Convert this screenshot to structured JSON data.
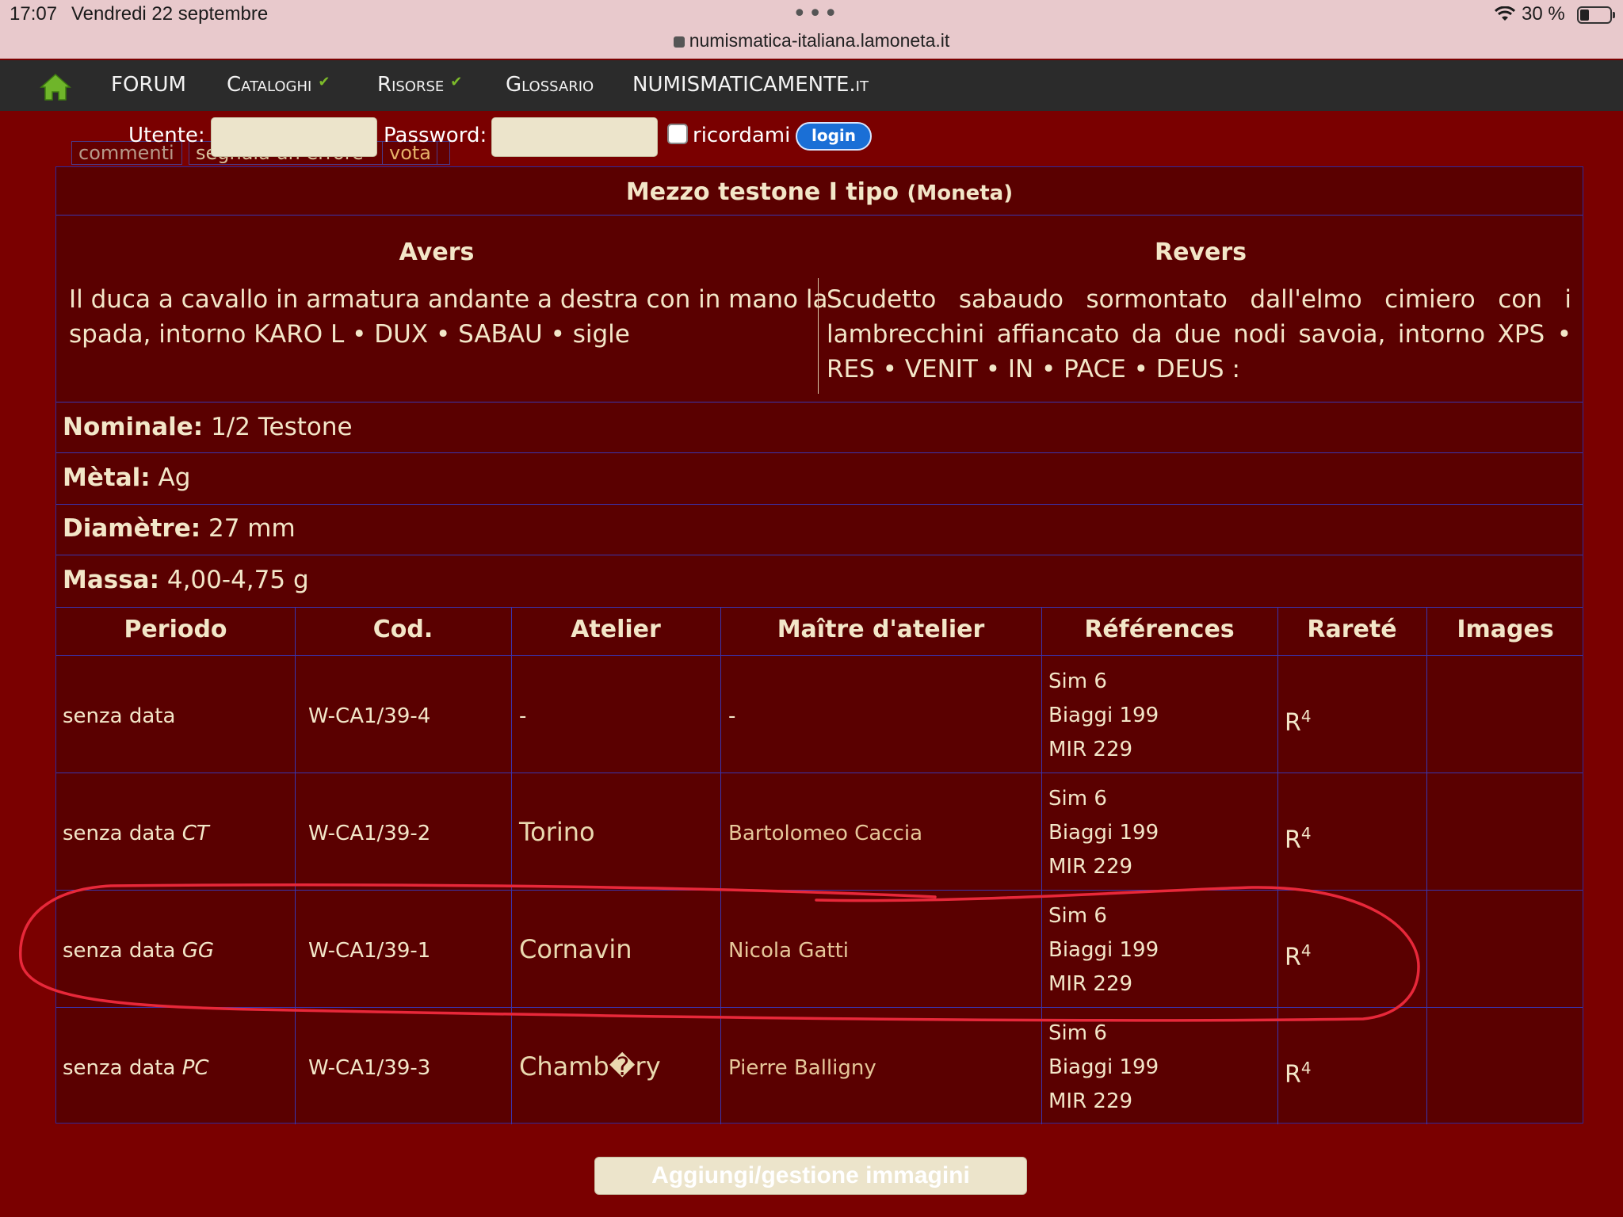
{
  "status": {
    "time": "17:07",
    "date": "Vendredi 22 septembre",
    "url": "numismatica-italiana.lamoneta.it",
    "battery": "30 %",
    "battery_level": 0.3
  },
  "nav": {
    "forum": "FORUM",
    "cataloghi": "Cataloghi",
    "risorse": "Risorse",
    "glossario": "Glossario",
    "numismaticamente": "NUMISMATICAMENTE.it"
  },
  "login": {
    "utente_label": "Utente:",
    "password_label": "Password:",
    "remember_label": "ricordami",
    "login_button": "login"
  },
  "tabs": [
    "commenti",
    "segnala un errore",
    "vota"
  ],
  "coin": {
    "title": "Mezzo testone I tipo",
    "kind": "(Moneta)",
    "avers_head": "Avers",
    "revers_head": "Revers",
    "avers_text": "Il duca a cavallo in armatura andante a destra con in mano la spada, intorno KARO L • DUX • SABAU • sigle",
    "revers_text": "Scudetto sabaudo sormontato dall'elmo cimiero con i lambrecchini affiancato da due nodi savoia, intorno XPS • RES • VENIT • IN • PACE • DEUS :",
    "nominale_label": "Nominale:",
    "nominale": "1/2 Testone",
    "metal_label": "Mètal:",
    "metal": "Ag",
    "diametre_label": "Diamètre:",
    "diametre": "27 mm",
    "massa_label": "Massa:",
    "massa": "4,00-4,75 g"
  },
  "table": {
    "headers": [
      "Periodo",
      "Cod.",
      "Atelier",
      "Maître d'atelier",
      "Références",
      "Rareté",
      "Images"
    ],
    "rows": [
      {
        "periodo": "senza data",
        "sigla": "",
        "cod": "W-CA1/39-4",
        "atelier": "-",
        "maitre": "-",
        "ref1": "Sim 6",
        "ref2": "Biaggi 199",
        "ref3": "MIR 229",
        "rarete": "R",
        "rarete_exp": "4"
      },
      {
        "periodo": "senza data",
        "sigla": "CT",
        "cod": "W-CA1/39-2",
        "atelier": "Torino",
        "maitre": "Bartolomeo Caccia",
        "ref1": "Sim 6",
        "ref2": "Biaggi 199",
        "ref3": "MIR 229",
        "rarete": "R",
        "rarete_exp": "4"
      },
      {
        "periodo": "senza data",
        "sigla": "GG",
        "cod": "W-CA1/39-1",
        "atelier": "Cornavin",
        "maitre": "Nicola Gatti",
        "ref1": "Sim 6",
        "ref2": "Biaggi 199",
        "ref3": "MIR 229",
        "rarete": "R",
        "rarete_exp": "4"
      },
      {
        "periodo": "senza data",
        "sigla": "PC",
        "cod": "W-CA1/39-3",
        "atelier": "Chamb�ry",
        "maitre": "Pierre Balligny",
        "ref1": "Sim 6",
        "ref2": "Biaggi 199",
        "ref3": "MIR 229",
        "rarete": "R",
        "rarete_exp": "4"
      }
    ]
  },
  "images_button": "Aggiungi/gestione immagini",
  "colors": {
    "page_bg": "#7a0000",
    "panel_bg": "#5a0000",
    "grid": "#3a35b0",
    "nav_bg": "#2b2b2b",
    "annotation": "#e8283a"
  }
}
